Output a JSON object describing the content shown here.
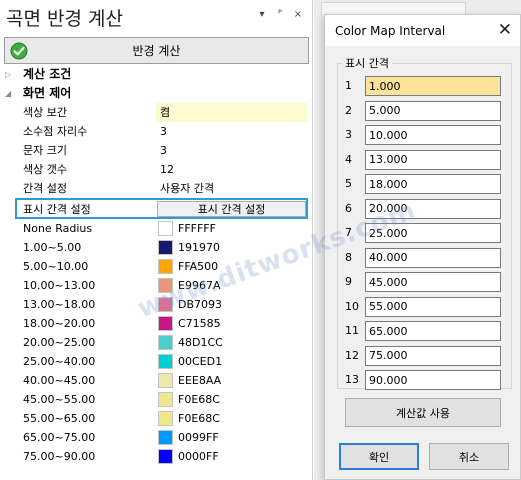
{
  "panel": {
    "title": "곡면 반경 계산",
    "header_buttons": [
      "▾",
      "ᴾ",
      "×"
    ],
    "calc_button_label": "반경 계산"
  },
  "groups": {
    "calc_conditions": "계산 조건",
    "surface_control": "화면 제어"
  },
  "properties": [
    {
      "key": "색상 보간",
      "value": "켬",
      "highlight": true
    },
    {
      "key": "소수점 자리수",
      "value": "3"
    },
    {
      "key": "문자 크기",
      "value": "3"
    },
    {
      "key": "색상 갯수",
      "value": "12"
    },
    {
      "key": "간격 설정",
      "value": "사용자 간격"
    }
  ],
  "selected_row": {
    "key": "표시 간격 설정",
    "button_label": "표시 간격 설정"
  },
  "color_rows": [
    {
      "range": "None Radius",
      "hex": "FFFFFF",
      "color": "#FFFFFF"
    },
    {
      "range": "1.00~5.00",
      "hex": "191970",
      "color": "#191970"
    },
    {
      "range": "5.00~10.00",
      "hex": "FFA500",
      "color": "#FFA500"
    },
    {
      "range": "10.00~13.00",
      "hex": "E9967A",
      "color": "#E9967A"
    },
    {
      "range": "13.00~18.00",
      "hex": "DB7093",
      "color": "#DB7093"
    },
    {
      "range": "18.00~20.00",
      "hex": "C71585",
      "color": "#C71585"
    },
    {
      "range": "20.00~25.00",
      "hex": "48D1CC",
      "color": "#48D1CC"
    },
    {
      "range": "25.00~40.00",
      "hex": "00CED1",
      "color": "#00CED1"
    },
    {
      "range": "40.00~45.00",
      "hex": "EEE8AA",
      "color": "#EEE8AA"
    },
    {
      "range": "45.00~55.00",
      "hex": "F0E68C",
      "color": "#F0E68C"
    },
    {
      "range": "55.00~65.00",
      "hex": "F0E68C",
      "color": "#F0E68C"
    },
    {
      "range": "65.00~75.00",
      "hex": "0099FF",
      "color": "#0099FF"
    },
    {
      "range": "75.00~90.00",
      "hex": "0000FF",
      "color": "#0000FF"
    }
  ],
  "dialog": {
    "title": "Color Map Interval",
    "close_glyph": "✕",
    "group_label": "표시 간격",
    "intervals": [
      {
        "num": "1",
        "value": "1.000"
      },
      {
        "num": "2",
        "value": "5.000"
      },
      {
        "num": "3",
        "value": "10.000"
      },
      {
        "num": "4",
        "value": "13.000"
      },
      {
        "num": "5",
        "value": "18.000"
      },
      {
        "num": "6",
        "value": "20.000"
      },
      {
        "num": "7",
        "value": "25.000"
      },
      {
        "num": "8",
        "value": "40.000"
      },
      {
        "num": "9",
        "value": "45.000"
      },
      {
        "num": "10",
        "value": "55.000"
      },
      {
        "num": "11",
        "value": "65.000"
      },
      {
        "num": "12",
        "value": "75.000"
      },
      {
        "num": "13",
        "value": "90.000"
      }
    ],
    "use_calc_label": "계산값 사용",
    "ok_label": "확인",
    "cancel_label": "취소"
  },
  "watermark": {
    "text": "www.ditworks.com"
  }
}
